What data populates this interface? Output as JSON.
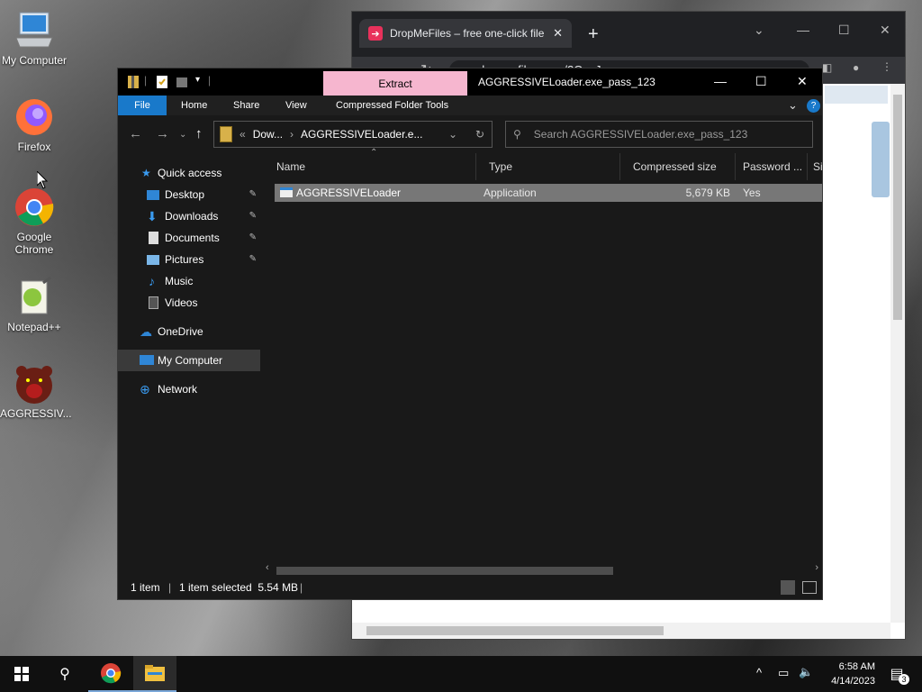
{
  "desktop": {
    "icons": [
      {
        "label": "My Computer"
      },
      {
        "label": "Firefox"
      },
      {
        "label": "Google Chrome"
      },
      {
        "label": "Notepad++"
      },
      {
        "label": "AGGRESSIV..."
      }
    ]
  },
  "chrome": {
    "tab_title": "DropMeFiles – free one-click file",
    "tab_close": "✕",
    "new_tab": "+",
    "url": "dropmefiles.com/2QqzJ",
    "controls": {
      "minimize": "—",
      "maximize": "☐",
      "close": "✕"
    }
  },
  "explorer": {
    "title": "AGGRESSIVELoader.exe_pass_123",
    "context_tab": "Extract",
    "ribbon": {
      "file": "File",
      "home": "Home",
      "share": "Share",
      "view": "View",
      "tools": "Compressed Folder Tools"
    },
    "address": {
      "prefix": "«",
      "part1": "Dow...",
      "sep": "›",
      "part2": "AGGRESSIVELoader.e...",
      "chevron": "⌄",
      "refresh": "↻"
    },
    "search_placeholder": "Search AGGRESSIVELoader.exe_pass_123",
    "sidebar": [
      {
        "label": "Quick access"
      },
      {
        "label": "Desktop",
        "pin": "📌"
      },
      {
        "label": "Downloads",
        "pin": "📌"
      },
      {
        "label": "Documents",
        "pin": "📌"
      },
      {
        "label": "Pictures",
        "pin": "📌"
      },
      {
        "label": "Music"
      },
      {
        "label": "Videos"
      },
      {
        "label": "OneDrive"
      },
      {
        "label": "My Computer"
      },
      {
        "label": "Network"
      }
    ],
    "columns": {
      "name": "Name",
      "type": "Type",
      "size": "Compressed size",
      "password": "Password ...",
      "extra": "Si"
    },
    "files": [
      {
        "name": "AGGRESSIVELoader",
        "type": "Application",
        "size": "5,679 KB",
        "password": "Yes"
      }
    ],
    "status": {
      "count": "1 item",
      "selected": "1 item selected  5.54 MB"
    }
  },
  "taskbar": {
    "time": "6:58 AM",
    "date": "4/14/2023",
    "notifications": "3"
  }
}
